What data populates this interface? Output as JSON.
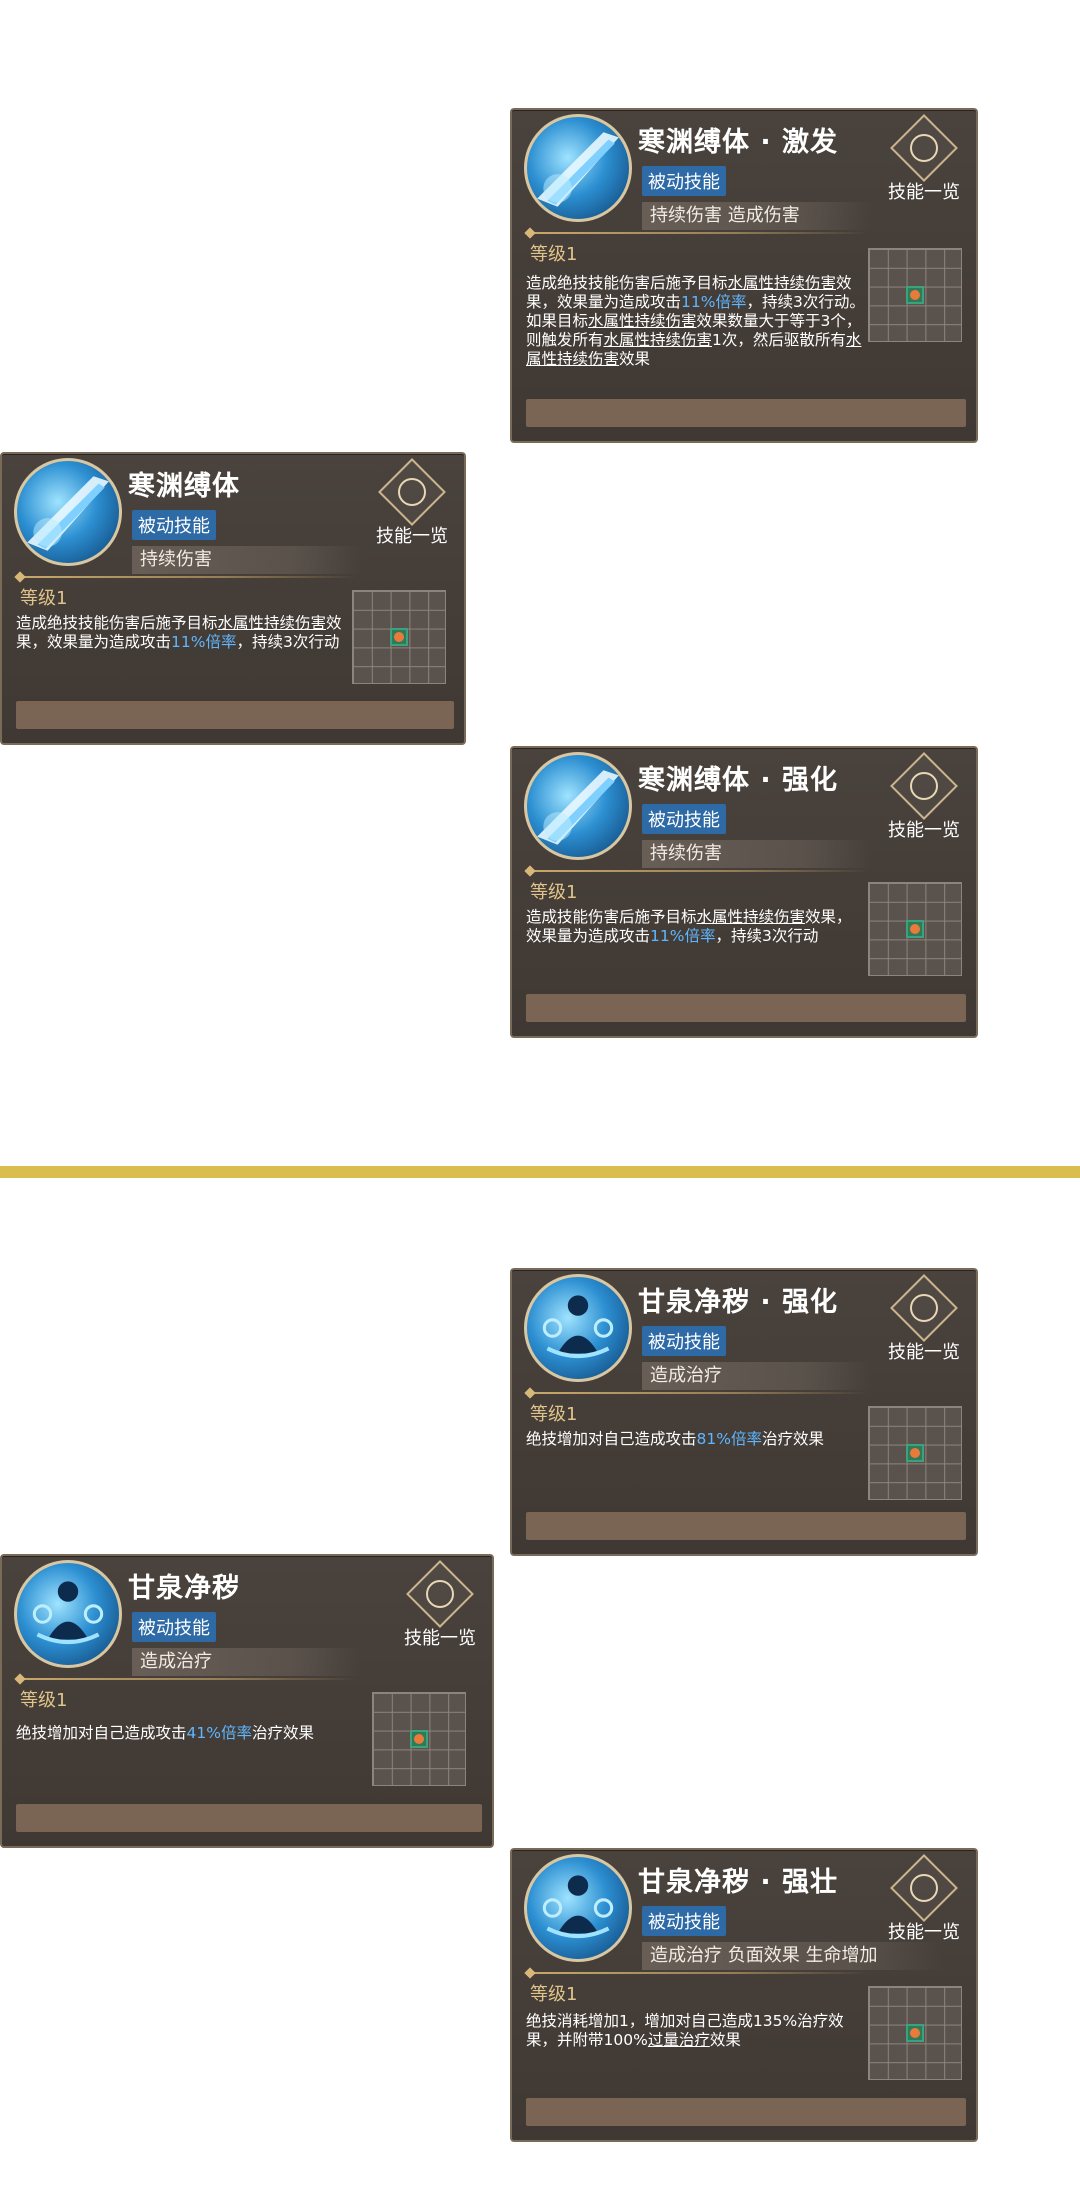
{
  "common": {
    "badge": "被动技能",
    "level": "等级1",
    "skill_list": "技能一览"
  },
  "cards": [
    {
      "title": "寒渊缚体 · 激发",
      "tags": "持续伤害 造成伤害",
      "desc": [
        "造成绝技技能伤害后施予目标",
        "水属性持续伤害",
        "效果，效果量为造成攻击",
        "11%倍率",
        "，持续3次行动。如果目标",
        "水属性持续伤害",
        "效果数量大于等于3个，则触发所有",
        "水属性持续伤害",
        "1次，然后驱散所有",
        "水属性持续伤害",
        "效果"
      ]
    },
    {
      "title": "寒渊缚体",
      "tags": "持续伤害",
      "desc": [
        "造成绝技技能伤害后施予目标",
        "水属性持续伤害",
        "效果，效果量为造成攻击",
        "11%倍率",
        "，持续3次行动"
      ]
    },
    {
      "title": "寒渊缚体 · 强化",
      "tags": "持续伤害",
      "desc": [
        "造成技能伤害后施予目标",
        "水属性持续伤害",
        "效果，效果量为造成攻击",
        "11%倍率",
        "，持续3次行动"
      ]
    },
    {
      "title": "甘泉净秽 · 强化",
      "tags": "造成治疗",
      "desc": [
        "绝技增加对自己造成攻击",
        "81%倍率",
        "治疗效果"
      ]
    },
    {
      "title": "甘泉净秽",
      "tags": "造成治疗",
      "desc": [
        "绝技增加对自己造成攻击",
        "41%倍率",
        "治疗效果"
      ]
    },
    {
      "title": "甘泉净秽 · 强壮",
      "tags": "造成治疗 负面效果 生命增加",
      "desc": [
        "绝技消耗增加1，增加对自己造成135%治疗效果，并附带100%",
        "过量治疗",
        "效果"
      ]
    }
  ]
}
